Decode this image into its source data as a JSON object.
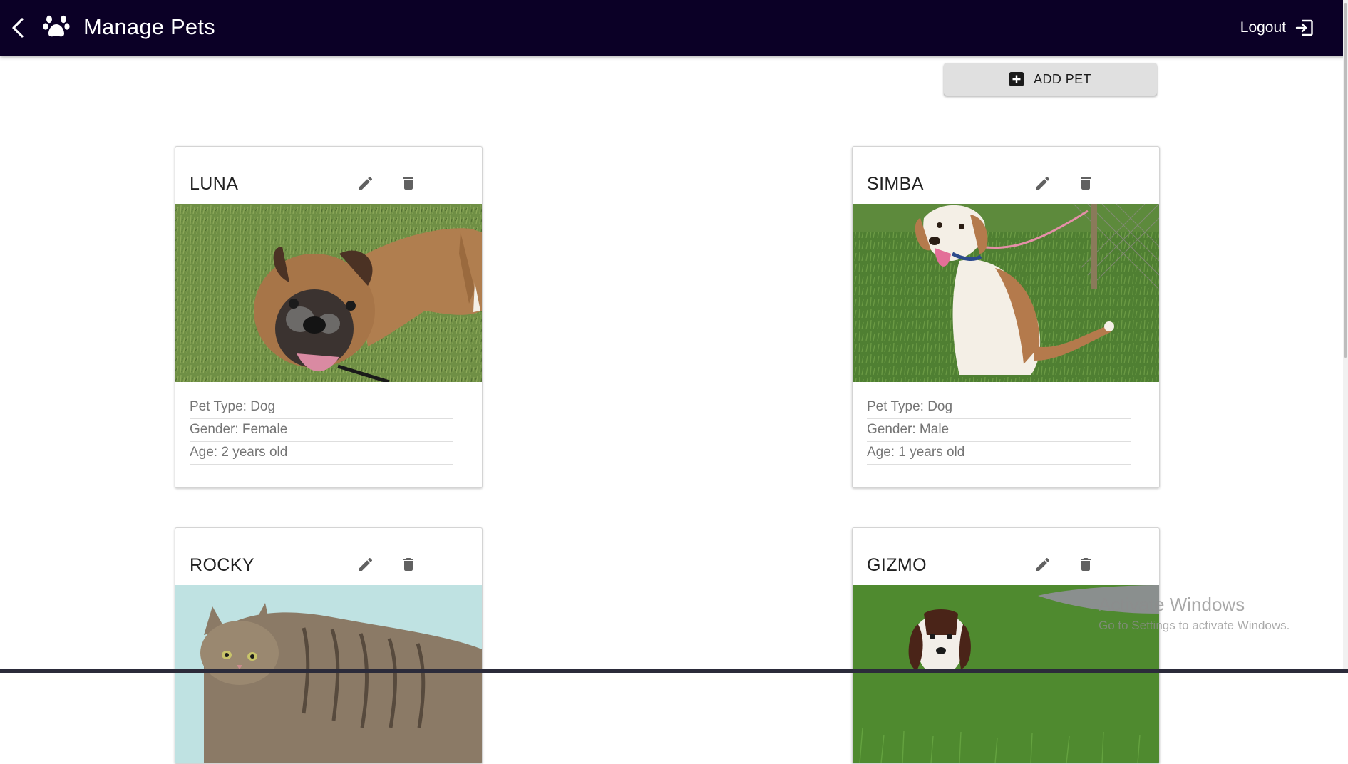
{
  "app": {
    "title": "Manage Pets",
    "logout_label": "Logout",
    "header_color": "#0b0026"
  },
  "toolbar": {
    "add_pet_label": "ADD PET"
  },
  "pets": [
    {
      "name": "LUNA",
      "type_text": "Pet Type: Dog",
      "gender_text": "Gender: Female",
      "age_text": "Age: 2 years old",
      "photo": "boxer-dog-on-grass"
    },
    {
      "name": "SIMBA",
      "type_text": "Pet Type: Dog",
      "gender_text": "Gender: Male",
      "age_text": "Age: 1 years old",
      "photo": "hound-dog-sitting-on-grass"
    },
    {
      "name": "ROCKY",
      "photo": "tabby-cat-on-light-blue"
    },
    {
      "name": "GIZMO",
      "photo": "spaniel-puppy-on-grass"
    }
  ],
  "watermark": {
    "title": "Activate Windows",
    "subtitle": "Go to Settings to activate Windows."
  },
  "icons": {
    "back": "chevron-left-icon",
    "brand": "paw-icon",
    "logout": "logout-icon",
    "add": "add-box-icon",
    "edit": "pencil-icon",
    "delete": "trash-icon"
  }
}
